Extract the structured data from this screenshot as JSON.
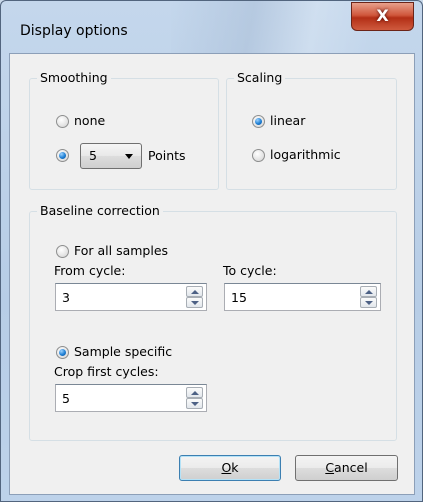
{
  "window": {
    "title": "Display options",
    "close_label": "X"
  },
  "smoothing": {
    "legend": "Smoothing",
    "none_label": "none",
    "points_value": "5",
    "points_label": "Points",
    "selected": "points"
  },
  "scaling": {
    "legend": "Scaling",
    "linear_label": "linear",
    "log_label": "logarithmic",
    "selected": "linear"
  },
  "baseline": {
    "legend": "Baseline correction",
    "all_label": "For all samples",
    "from_label": "From cycle:",
    "from_value": "3",
    "to_label": "To cycle:",
    "to_value": "15",
    "specific_label": "Sample specific",
    "crop_label": "Crop first cycles:",
    "crop_value": "5",
    "selected": "specific"
  },
  "buttons": {
    "ok_mnemonic": "O",
    "ok_rest": "k",
    "cancel_mnemonic": "C",
    "cancel_rest": "ancel"
  },
  "colors": {
    "frame": "#b7cde6",
    "client": "#f0f0f0",
    "close": "#c8432a",
    "radio_selected": "#1e7fd4"
  }
}
